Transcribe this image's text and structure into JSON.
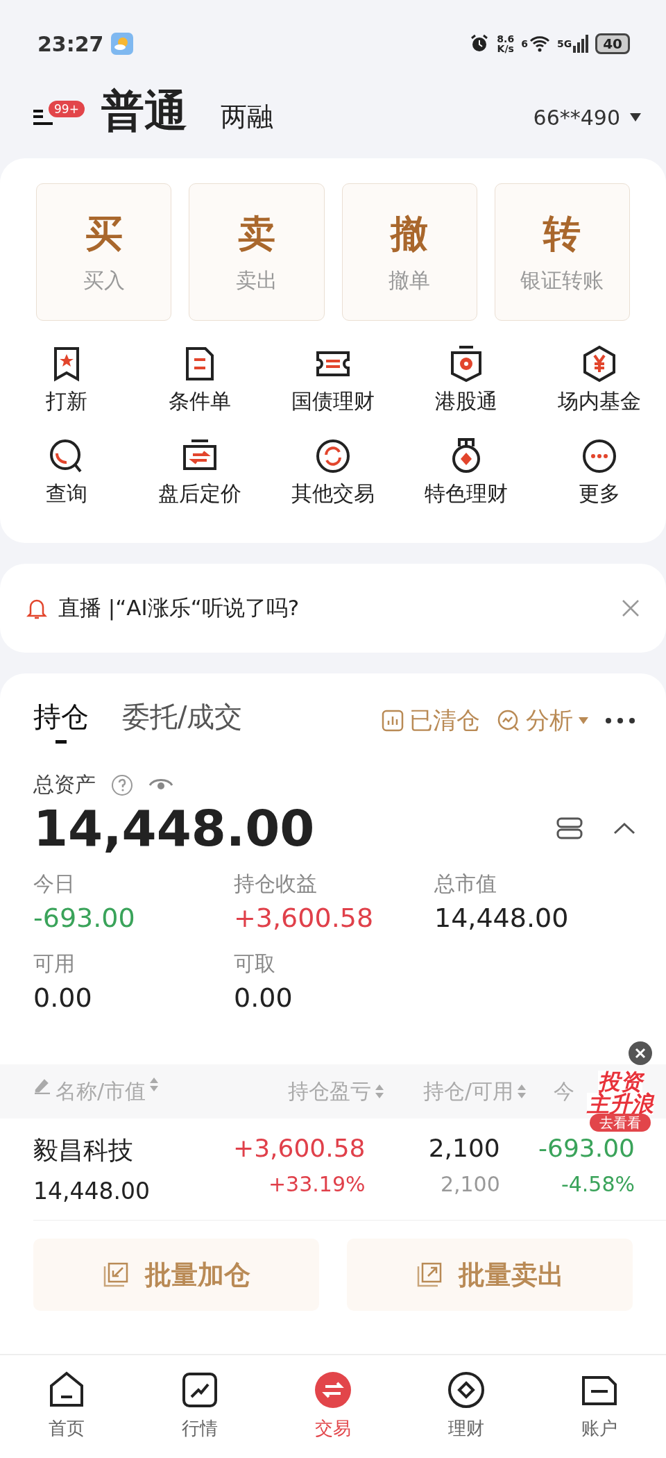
{
  "status_bar": {
    "time": "23:27",
    "speed_value": "8.6",
    "speed_unit": "K/s",
    "wifi_label": "6",
    "cell_label": "5G",
    "battery": "40"
  },
  "header": {
    "badge": "99+",
    "modes": [
      {
        "label": "普通",
        "selected": true
      },
      {
        "label": "两融",
        "selected": false
      }
    ],
    "account": "66**490"
  },
  "quick_actions": [
    {
      "glyph": "买",
      "label": "买入"
    },
    {
      "glyph": "卖",
      "label": "卖出"
    },
    {
      "glyph": "撤",
      "label": "撤单"
    },
    {
      "glyph": "转",
      "label": "银证转账"
    }
  ],
  "shortcuts": [
    {
      "kind": "ipo",
      "label": "打新"
    },
    {
      "kind": "condition",
      "label": "条件单"
    },
    {
      "kind": "bond",
      "label": "国债理财"
    },
    {
      "kind": "hk",
      "label": "港股通"
    },
    {
      "kind": "fund",
      "label": "场内基金"
    },
    {
      "kind": "query",
      "label": "查询"
    },
    {
      "kind": "afterhours",
      "label": "盘后定价"
    },
    {
      "kind": "other",
      "label": "其他交易"
    },
    {
      "kind": "special",
      "label": "特色理财"
    },
    {
      "kind": "more",
      "label": "更多"
    }
  ],
  "notice": {
    "text": "直播 |“AI涨乐“听说了吗?"
  },
  "holdings": {
    "tabs": [
      {
        "label": "持仓",
        "selected": true
      },
      {
        "label": "委托/成交",
        "selected": false
      }
    ],
    "actions": [
      {
        "kind": "cleared",
        "label": "已清仓"
      },
      {
        "kind": "analysis",
        "label": "分析"
      }
    ],
    "total_label": "总资产",
    "total": "14,448.00",
    "stats": [
      {
        "label": "今日",
        "value": "-693.00",
        "color": "#3aa35a"
      },
      {
        "label": "持仓收益",
        "value": "+3,600.58",
        "color": "#e0404a"
      },
      {
        "label": "总市值",
        "value": "14,448.00",
        "color": "#222222"
      },
      {
        "label": "可用",
        "value": "0.00",
        "color": "#222222"
      },
      {
        "label": "可取",
        "value": "0.00",
        "color": "#222222"
      }
    ],
    "columns": [
      {
        "label": "名称/市值",
        "sortable": true
      },
      {
        "label": "持仓盈亏",
        "sortable": true
      },
      {
        "label": "持仓/可用",
        "sortable": true
      },
      {
        "label": "今",
        "sortable": false
      }
    ],
    "rows": [
      {
        "cells": [
          {
            "value": "毅昌科技",
            "color": "#222222",
            "sub": {
              "text": "14,448.00",
              "color": "#222222"
            }
          },
          {
            "value": "+3,600.58",
            "color": "#e0404a",
            "sub": {
              "text": "+33.19%",
              "color": "#e0404a"
            }
          },
          {
            "value": "2,100",
            "color": "#222222",
            "sub": {
              "text": "2,100",
              "color": "#999999"
            }
          },
          {
            "value": "-693.00",
            "color": "#3aa35a",
            "sub": {
              "text": "-4.58%",
              "color": "#3aa35a"
            }
          }
        ]
      }
    ],
    "buttons": [
      {
        "kind": "add",
        "label": "批量加仓"
      },
      {
        "kind": "sell",
        "label": "批量卖出"
      }
    ]
  },
  "promo": {
    "title_1": "投资",
    "title_2": "主升浪",
    "action": "去看看"
  },
  "tabbar": [
    {
      "kind": "home",
      "label": "首页",
      "selected": false
    },
    {
      "kind": "market",
      "label": "行情",
      "selected": false
    },
    {
      "kind": "trade",
      "label": "交易",
      "selected": true
    },
    {
      "kind": "wealth",
      "label": "理财",
      "selected": false
    },
    {
      "kind": "account",
      "label": "账户",
      "selected": false
    }
  ]
}
